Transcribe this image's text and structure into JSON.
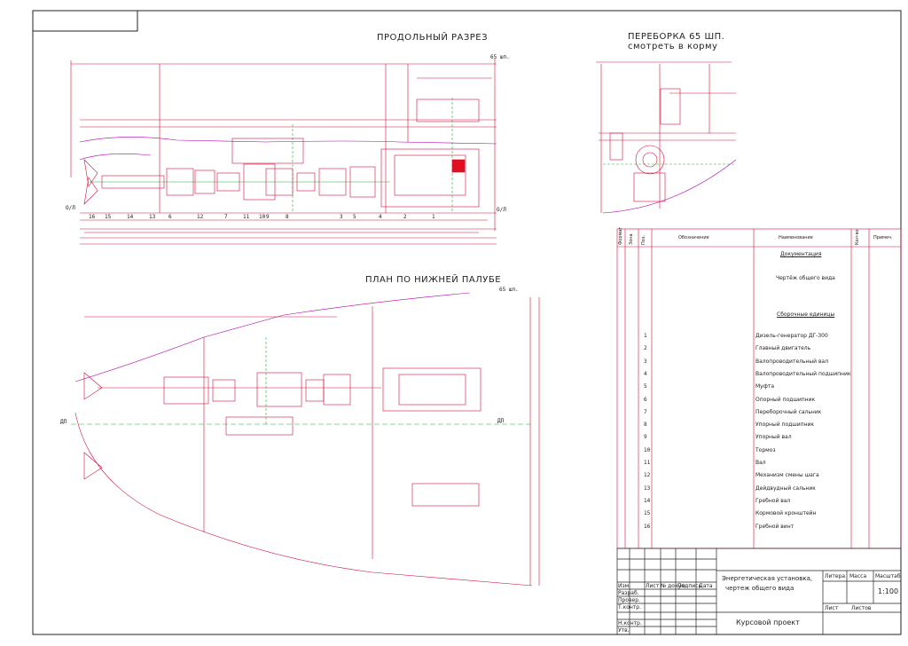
{
  "views": {
    "longitudinal_title": "ПРОДОЛЬНЫЙ РАЗРЕЗ",
    "plan_title": "ПЛАН ПО НИЖНЕЙ ПАЛУБЕ",
    "bulkhead_title_1": "ПЕРЕБОРКА 65 ШП.",
    "bulkhead_title_2": "смотреть в корму",
    "frame_mark": "65 шп.",
    "dp_mark": "ДП",
    "ol_mark": "О/Л"
  },
  "section_positions": [
    "16",
    "15",
    "14",
    "13",
    "12",
    "11",
    "10",
    "9",
    "8",
    "7",
    "6",
    "5",
    "4",
    "3",
    "2",
    "1"
  ],
  "spec_table": {
    "headers": {
      "format": "Формат",
      "zone": "Зона",
      "pos": "Поз.",
      "designation": "Обозначение",
      "name": "Наименование",
      "qty": "Кол-во",
      "note": "Примеч."
    },
    "section_docs": "Документация",
    "doc_item": "Чертёж общего вида",
    "section_units": "Сборочные единицы",
    "items": [
      {
        "pos": "1",
        "name": "Дизель-генератор ДГ-300"
      },
      {
        "pos": "2",
        "name": "Главный двигатель"
      },
      {
        "pos": "3",
        "name": "Валопроводительный вал"
      },
      {
        "pos": "4",
        "name": "Валопроводительный подшипник"
      },
      {
        "pos": "5",
        "name": "Муфта"
      },
      {
        "pos": "6",
        "name": "Опорный подшипник"
      },
      {
        "pos": "7",
        "name": "Переборочный сальник"
      },
      {
        "pos": "8",
        "name": "Упорный подшипник"
      },
      {
        "pos": "9",
        "name": "Упорный вал"
      },
      {
        "pos": "10",
        "name": "Тормоз"
      },
      {
        "pos": "11",
        "name": "Вал"
      },
      {
        "pos": "12",
        "name": "Механизм смены шага"
      },
      {
        "pos": "13",
        "name": "Дейдвудный сальник"
      },
      {
        "pos": "14",
        "name": "Гребной вал"
      },
      {
        "pos": "15",
        "name": "Кормовой кронштейн"
      },
      {
        "pos": "16",
        "name": "Гребной винт"
      }
    ]
  },
  "title_block": {
    "project_title_1": "Энергетическая установка,",
    "project_title_2": "чертеж общего вида",
    "course": "Курсовой проект",
    "stage": "Литера",
    "mass": "Масса",
    "scale_label": "Масштаб",
    "scale": "1:100",
    "sheet": "Лист",
    "sheets": "Листов",
    "roles": [
      "Изм.",
      "Лист",
      "№ докум.",
      "Подпись",
      "Дата"
    ],
    "signers": [
      "Разраб.",
      "Провер.",
      "Т.контр.",
      "",
      "Н.контр.",
      "Утв."
    ]
  },
  "colors": {
    "line": "#d0103a",
    "frame": "#222222",
    "green": "#1fae3a",
    "violet": "#b000b0"
  }
}
